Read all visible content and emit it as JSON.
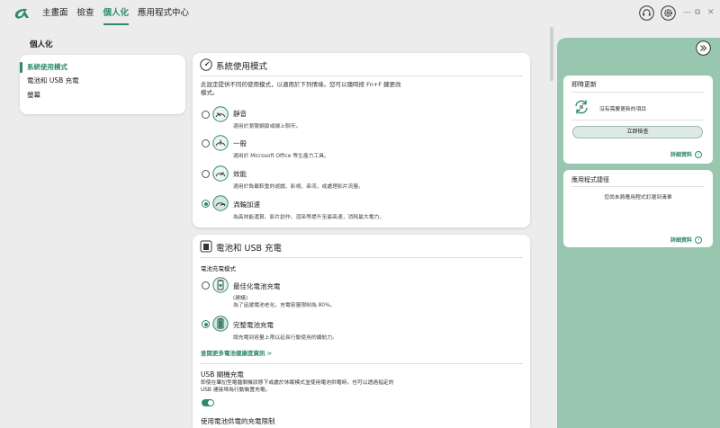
{
  "app": {
    "accent_color": "#2e8b6a",
    "panel_color": "#98c6ae"
  },
  "nav": {
    "items": [
      {
        "label": "主畫面"
      },
      {
        "label": "檢查"
      },
      {
        "label": "個人化"
      },
      {
        "label": "應用程式中心"
      }
    ],
    "active_index": 2
  },
  "window_controls": {
    "minimize": "—",
    "restore": "⧉",
    "close": "✕"
  },
  "left_pane": {
    "title": "個人化",
    "items": [
      {
        "label": "系統使用模式"
      },
      {
        "label": "電池和 USB 充電"
      },
      {
        "label": "螢幕"
      }
    ],
    "active_index": 0
  },
  "usage_mode": {
    "title": "系統使用模式",
    "description": "此設定提供不同的使用模式，以適用於下列情境。您可以隨時按 Fn+F 鍵更改模式。",
    "options": [
      {
        "title": "靜音",
        "desc": "適用於瀏覽網頁或線上聊天。",
        "icon": "quiet-gauge-icon",
        "checked": false
      },
      {
        "title": "一般",
        "desc": "適用於 Microsoft Office 等生產力工具。",
        "icon": "normal-gauge-icon",
        "checked": false
      },
      {
        "title": "效能",
        "desc": "適用於負載較重的遊戲、影視、串流，或處理影片流量。",
        "icon": "performance-gauge-icon",
        "checked": false
      },
      {
        "title": "渦輪加速",
        "desc": "為高效能運算、影片創作、渲染等提升至最高速，消耗最大電力。",
        "icon": "turbo-gauge-icon",
        "checked": true
      }
    ]
  },
  "battery": {
    "title": "電池和 USB 充電",
    "section_label": "電池充電模式",
    "options": [
      {
        "title": "最佳化電池充電",
        "tag": "(建議)",
        "desc": "為了延緩電池老化，充電容量限制為 80%。",
        "icon": "battery-heart-icon",
        "checked": false
      },
      {
        "title": "完整電池充電",
        "desc": "請充電到容量上限以延長行動使用的續航力。",
        "icon": "battery-full-icon",
        "checked": true
      }
    ],
    "link": "查閱更多電池健康度資訊 >",
    "usb_title": "USB 關機充電",
    "usb_desc": "即使在筆記型電腦關機狀態下或處於休眠模式並使用電池供電時，也可以透過指定的 USB 連接埠為行動裝置充電。",
    "usb_toggle_on": true,
    "limit_title": "使用電池供電的充電限制"
  },
  "right_panel": {
    "updates": {
      "title": "即時更新",
      "status": "沒有需要更新的項目",
      "button": "立即檢查",
      "details": "詳細資料"
    },
    "shortcuts": {
      "title": "應用程式捷徑",
      "empty": "您尚未將應用程式釘選到清單",
      "details": "詳細資料"
    }
  }
}
